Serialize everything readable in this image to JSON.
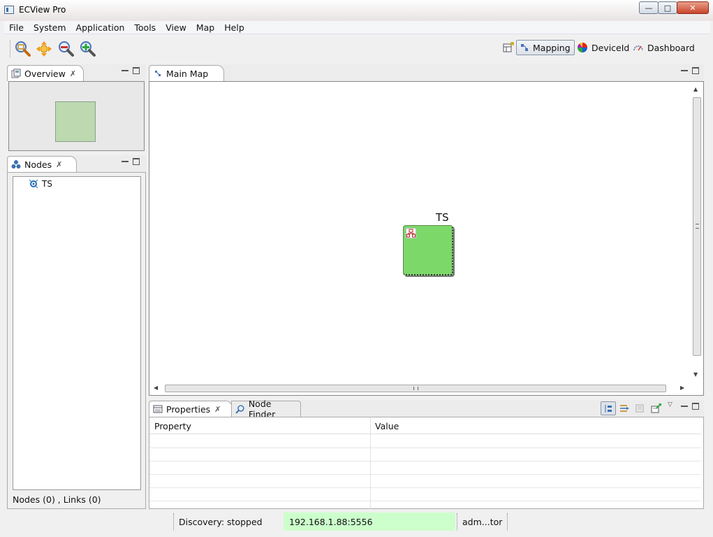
{
  "window": {
    "title": "ECView Pro"
  },
  "menu": [
    "File",
    "System",
    "Application",
    "Tools",
    "View",
    "Map",
    "Help"
  ],
  "toolbar": {
    "icons": [
      "zoom-fit-icon",
      "pan-icon",
      "zoom-out-icon",
      "zoom-in-icon"
    ],
    "perspectives": [
      {
        "label": "Mapping",
        "icon": "mapping-icon",
        "selected": true
      },
      {
        "label": "DeviceId",
        "icon": "color-wheel-icon",
        "selected": false
      },
      {
        "label": "Dashboard",
        "icon": "gauge-icon",
        "selected": false
      }
    ]
  },
  "overview": {
    "tab_label": "Overview"
  },
  "nodes": {
    "tab_label": "Nodes",
    "tree_items": [
      {
        "label": "TS"
      }
    ],
    "footer": "Nodes (0) , Links (0)"
  },
  "main_map": {
    "tab_label": "Main Map",
    "node": {
      "label": "TS",
      "color": "#7dd86a"
    }
  },
  "properties": {
    "tab_label": "Properties",
    "node_finder_label": "Node Finder",
    "columns": [
      "Property",
      "Value"
    ],
    "rows": [
      [
        "",
        ""
      ],
      [
        "",
        ""
      ],
      [
        "",
        ""
      ],
      [
        "",
        ""
      ],
      [
        "",
        ""
      ],
      [
        "",
        ""
      ]
    ]
  },
  "status": {
    "discovery": "Discovery: stopped",
    "server": "192.168.1.88:5556",
    "user": "adm...tor",
    "server_bg": "#ccffcc"
  }
}
